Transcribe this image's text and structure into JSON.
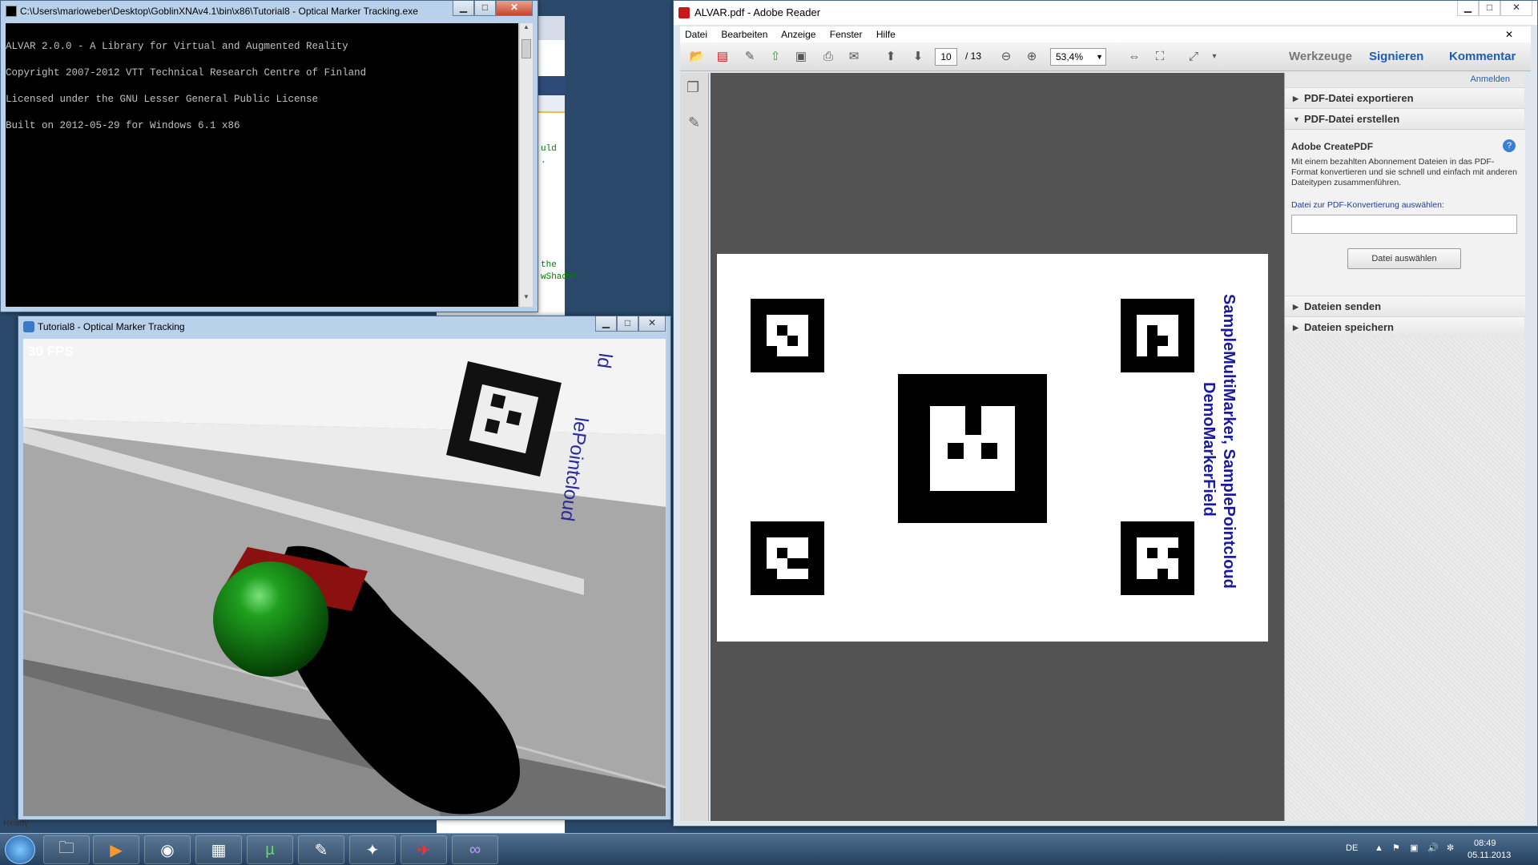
{
  "desktop": {
    "bg": "#2b4a6b"
  },
  "console_window": {
    "title": "C:\\Users\\marioweber\\Desktop\\GoblinXNAv4.1\\bin\\x86\\Tutorial8 - Optical Marker Tracking.exe",
    "lines": [
      "ALVAR 2.0.0 - A Library for Virtual and Augmented Reality",
      "Copyright 2007-2012 VTT Technical Research Centre of Finland",
      "Licensed under the GNU Lesser General Public License",
      "Built on 2012-05-29 for Windows 6.1 x86"
    ]
  },
  "ide_background": {
    "code_fragments": [
      "uld",
      ".",
      "the",
      "wShader"
    ],
    "status": "Ready"
  },
  "tracking_window": {
    "title": "Tutorial8 - Optical Marker Tracking",
    "fps": "30 FPS",
    "camera_text_1": "lePointcloud",
    "camera_text_2": "ld"
  },
  "reader_window": {
    "title": "ALVAR.pdf - Adobe Reader",
    "menu": [
      "Datei",
      "Bearbeiten",
      "Anzeige",
      "Fenster",
      "Hilfe"
    ],
    "page_current": "10",
    "page_total": "/ 13",
    "zoom": "53,4%",
    "tabs": [
      "Werkzeuge",
      "Signieren",
      "Kommentar"
    ],
    "signin": "Anmelden",
    "page_text_1": "SampleMultiMarker, SamplePointcloud",
    "page_text_2": "DemoMarkerField",
    "panel": {
      "export": "PDF-Datei exportieren",
      "create": "PDF-Datei erstellen",
      "create_title": "Adobe CreatePDF",
      "create_desc": "Mit einem bezahlten Abonnement Dateien in das PDF-Format konvertieren und sie schnell und einfach mit anderen Dateitypen zusammenführen.",
      "file_label": "Datei zur PDF-Konvertierung auswählen:",
      "choose_button": "Datei auswählen",
      "send": "Dateien senden",
      "save": "Dateien speichern"
    }
  },
  "taskbar": {
    "language": "DE",
    "time": "08:49",
    "date": "05.11.2013",
    "apps": [
      "start",
      "explorer",
      "media-player",
      "chrome",
      "winrar",
      "utorrent",
      "notepad",
      "game-controller",
      "adobe-reader",
      "visual-studio"
    ]
  },
  "colors": {
    "reader_bg": "#535353",
    "panel_bg": "#f2f2f2",
    "accent_blue": "#1c3f95",
    "page_text": "#1a1aa0"
  }
}
